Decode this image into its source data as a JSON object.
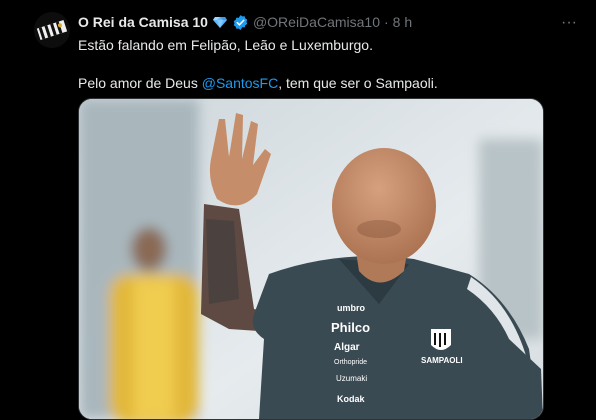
{
  "tweet": {
    "display_name": "O Rei da Camisa 10",
    "handle": "@OReiDaCamisa10",
    "separator": "·",
    "time": "8 h",
    "text_line1": "Estão falando em Felipão, Leão e Luxemburgo.",
    "text_line2_before": "Pelo amor de Deus ",
    "mention": "@SantosFC",
    "text_line2_after": ", tem que ser o Sampaoli.",
    "more_label": "···"
  },
  "photo": {
    "sponsor_1": "Philco",
    "sponsor_2": "Algar",
    "sponsor_3": "Orthopride",
    "sponsor_4": "Uzumaki",
    "sponsor_5": "Kodak",
    "kit_brand": "umbro",
    "shirt_name": "SAMPAOLI"
  },
  "colors": {
    "background": "#000000",
    "text": "#e7e9ea",
    "muted": "#71767b",
    "link": "#1d9bf0",
    "shirt": "#3a4a52"
  },
  "icons": {
    "verified": "verified-badge-icon",
    "gem": "diamond-gem-icon",
    "more": "more-options-icon"
  }
}
